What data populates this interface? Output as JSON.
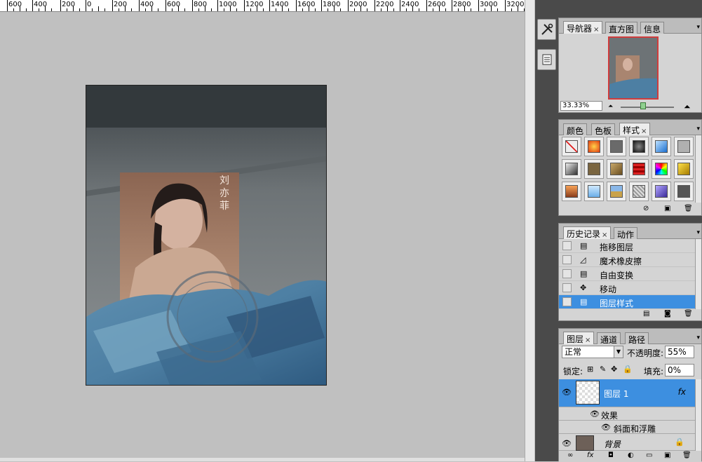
{
  "ruler": {
    "labels": [
      "600",
      "400",
      "200",
      "0",
      "200",
      "400",
      "600",
      "800",
      "1000",
      "1200",
      "1400",
      "1600",
      "1800",
      "2000",
      "2200",
      "2400",
      "2600",
      "2800",
      "3000",
      "3200"
    ]
  },
  "navigator_panel": {
    "tabs": [
      {
        "label": "导航器",
        "close": "×"
      },
      {
        "label": "直方图"
      },
      {
        "label": "信息"
      }
    ],
    "zoom": "33.33%"
  },
  "styles_panel": {
    "tabs": [
      {
        "label": "颜色"
      },
      {
        "label": "色板"
      },
      {
        "label": "样式",
        "close": "×"
      }
    ],
    "swatches": [
      "none",
      "orange-glow",
      "gray",
      "dark-button",
      "blue-glass",
      "light-gray",
      "gray-gradient",
      "brown",
      "bronze",
      "red-stripes",
      "multicolor",
      "yellow-frame",
      "sunset",
      "sky",
      "landscape",
      "texture",
      "purple",
      "dark-gray"
    ]
  },
  "history_panel": {
    "tabs": [
      {
        "label": "历史记录",
        "close": "×"
      },
      {
        "label": "动作"
      }
    ],
    "items": [
      {
        "label": "拖移图层",
        "icon": "document-icon"
      },
      {
        "label": "魔术橡皮擦",
        "icon": "eraser-icon"
      },
      {
        "label": "自由变换",
        "icon": "document-icon"
      },
      {
        "label": "移动",
        "icon": "move-icon"
      },
      {
        "label": "图层样式",
        "icon": "document-icon"
      }
    ]
  },
  "layers_panel": {
    "tabs": [
      {
        "label": "图层",
        "close": "×"
      },
      {
        "label": "通道"
      },
      {
        "label": "路径"
      }
    ],
    "blend_mode": "正常",
    "opacity_label": "不透明度:",
    "opacity_value": "55%",
    "lock_label": "锁定:",
    "fill_label": "填充:",
    "fill_value": "0%",
    "layers": [
      {
        "name": "图层 1",
        "fx": "fx"
      },
      {
        "name": "效果"
      },
      {
        "name": "斜面和浮雕"
      },
      {
        "name": "背景"
      }
    ]
  },
  "colors": {
    "selection": "#3d8fe0",
    "panel_bg": "#d4d4d4",
    "canvas_bg": "#c0c0c0",
    "thumb_border": "#d03c3c"
  }
}
